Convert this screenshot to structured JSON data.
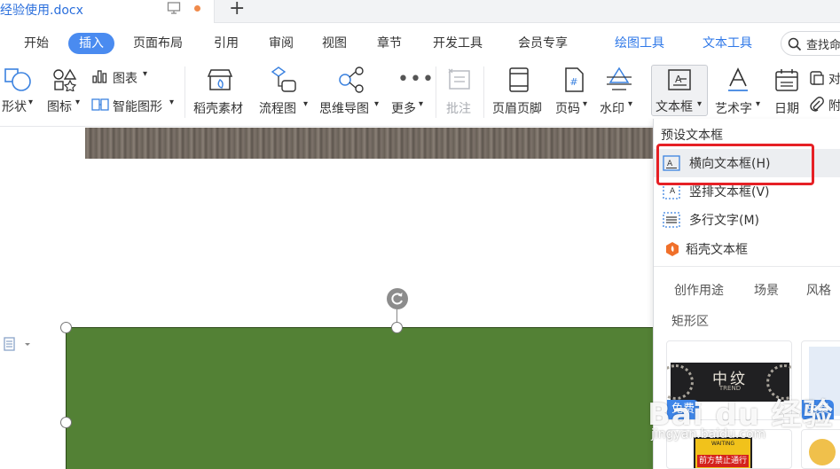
{
  "tab": {
    "doc_title": "经验使用.docx",
    "new_tab": "+"
  },
  "menu": {
    "items": [
      "开始",
      "插入",
      "页面布局",
      "引用",
      "审阅",
      "视图",
      "章节",
      "开发工具",
      "会员专享"
    ],
    "context_items": [
      "绘图工具",
      "文本工具"
    ],
    "active": "插入",
    "search_label": "查找命"
  },
  "ribbon": {
    "shapes": "形状",
    "icons": "图标",
    "chart": "图表",
    "smart_shape": "智能图形",
    "daoke_material": "稻壳素材",
    "flowchart": "流程图",
    "mindmap": "思维导图",
    "more": "更多",
    "comment": "批注",
    "header_footer": "页眉页脚",
    "page_number": "页码",
    "watermark": "水印",
    "textbox": "文本框",
    "wordart": "艺术字",
    "date": "日期",
    "object": "对",
    "attachment": "附"
  },
  "textbox_menu": {
    "preset_title": "预设文本框",
    "items": [
      "横向文本框(H)",
      "竖排文本框(V)",
      "多行文字(M)"
    ],
    "daoke": "稻壳文本框",
    "tabs": [
      "创作用途",
      "场景",
      "风格"
    ],
    "sub_heading": "矩形区",
    "card1_title": "中纹",
    "card1_sub": "TREND",
    "free_badge": "免费",
    "warn_top": "WAITING",
    "warn_text": "前方禁止通行"
  },
  "watermark": {
    "brand": "Bai du 经验",
    "url": "jingyan.baidu.com"
  },
  "colors": {
    "accent_blue": "#4a8bf0",
    "shape_green": "#538135",
    "highlight_red": "#e62025"
  }
}
